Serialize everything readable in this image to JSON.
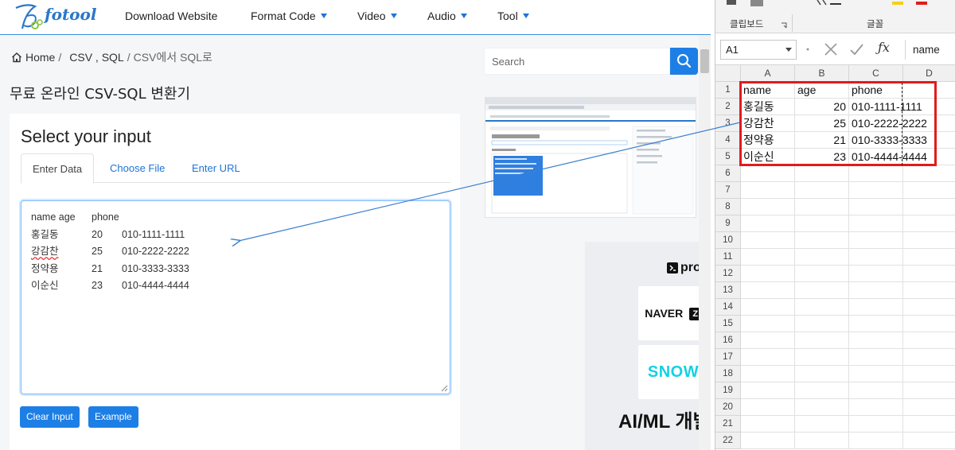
{
  "site": {
    "logo_text": "fotool",
    "nav": [
      {
        "label": "Download Website",
        "has_caret": false
      },
      {
        "label": "Format Code",
        "has_caret": true
      },
      {
        "label": "Video",
        "has_caret": true
      },
      {
        "label": "Audio",
        "has_caret": true
      },
      {
        "label": "Tool",
        "has_caret": true
      }
    ],
    "accent": "#1d7fe6"
  },
  "breadcrumb": {
    "home": "Home",
    "sep1": "/",
    "section": "CSV , SQL",
    "sep2": "/",
    "current": "CSV에서 SQL로"
  },
  "page_title": "무료 온라인 CSV-SQL 변환기",
  "input_card": {
    "title": "Select your input",
    "tabs": [
      "Enter Data",
      "Choose File",
      "Enter URL"
    ],
    "active_tab": "Enter Data",
    "textarea_lines": [
      [
        "name age",
        "phone",
        ""
      ],
      [
        "홍길동",
        "20",
        "010-1111-1111"
      ],
      [
        "강감찬",
        "25",
        "010-2222-2222"
      ],
      [
        "정약용",
        "21",
        "010-3333-3333"
      ],
      [
        "이순신",
        "23",
        "010-4444-4444"
      ]
    ],
    "buttons": {
      "clear": "Clear Input",
      "example": "Example"
    }
  },
  "search": {
    "placeholder": "Search",
    "icon": "search-icon"
  },
  "ad": {
    "brand_text": "progr",
    "naver": "NAVER",
    "naver_badge": "Z",
    "snow": "SNOW",
    "bottom_text": "AI/ML 개발",
    "snow_color": "#14d1e4"
  },
  "excel": {
    "ribbon_groups": [
      "클립보드",
      "글꼴"
    ],
    "name_box": "A1",
    "formula_value": "name",
    "columns": [
      "A",
      "B",
      "C",
      "D"
    ],
    "row_numbers": [
      "1",
      "2",
      "3",
      "4",
      "5",
      "6",
      "7",
      "8",
      "9",
      "10",
      "11",
      "12",
      "13",
      "14",
      "15",
      "16",
      "17",
      "18",
      "19",
      "20",
      "21",
      "22"
    ],
    "rows": [
      {
        "name": "name",
        "age": "age",
        "phone": "phone",
        "header": true
      },
      {
        "name": "홍길동",
        "age": "20",
        "phone": "010-1111-1111"
      },
      {
        "name": "강감찬",
        "age": "25",
        "phone": "010-2222-2222"
      },
      {
        "name": "정약용",
        "age": "21",
        "phone": "010-3333-3333"
      },
      {
        "name": "이순신",
        "age": "23",
        "phone": "010-4444-4444"
      }
    ],
    "highlight_color": "#e21b1b"
  }
}
